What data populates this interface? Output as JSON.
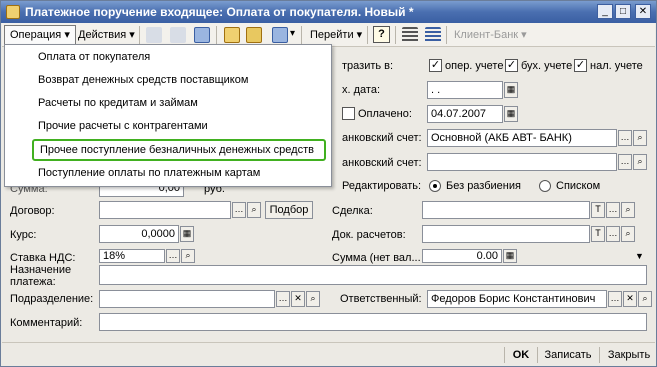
{
  "window": {
    "title": "Платежное поручение входящее: Оплата от покупателя. Новый *",
    "btn_min": "_",
    "btn_max": "□",
    "btn_close": "✕"
  },
  "toolbar": {
    "operation": "Операция",
    "actions": "Действия",
    "goto": "Перейти",
    "help": "?",
    "client_bank": "Клиент-Банк"
  },
  "menu": {
    "items": [
      "Оплата от покупателя",
      "Возврат денежных средств поставщиком",
      "Расчеты по кредитам и займам",
      "Прочие расчеты с контрагентами",
      "Прочее поступление безналичных денежных средств",
      "Поступление оплаты по платежным картам"
    ]
  },
  "form": {
    "reflect_label": "тразить в:",
    "oper_label": "опер. учете",
    "buh_label": "бух. учете",
    "nal_label": "нал. учете",
    "vh_date_label": "х. дата:",
    "vh_date_value": ". .",
    "paid_label": "Оплачено:",
    "paid_date": "04.07.2007",
    "bank_account_label": "анковский счет:",
    "bank_account_value": "Основной (АКБ АВТ- БАНК)",
    "bank_account2_label": "анковский счет:",
    "sum_label": "Сумма:",
    "sum_value": "0,00",
    "sum_currency": "руб.",
    "edit_label": "Редактировать:",
    "edit_opt1": "Без разбиения",
    "edit_opt2": "Списком",
    "contract_label": "Договор:",
    "select_button": "Подбор",
    "deal_label": "Сделка:",
    "rate_label": "Курс:",
    "rate_value": "0,0000",
    "doc_calc_label": "Док. расчетов:",
    "vat_label": "Ставка НДС:",
    "vat_value": "18%",
    "vat_sum_label": "Сумма (нет вал...",
    "vat_sum_value": "0.00",
    "purpose_label_1": "Назначение",
    "purpose_label_2": "платежа:",
    "division_label": "Подразделение:",
    "responsible_label": "Ответственный:",
    "responsible_value": "Федоров Борис Константинович",
    "comment_label": "Комментарий:"
  },
  "footer": {
    "ok": "OK",
    "save": "Записать",
    "close": "Закрыть"
  },
  "colors": {
    "title_bar": "#4a6fb0",
    "highlight_border": "#41b020"
  }
}
